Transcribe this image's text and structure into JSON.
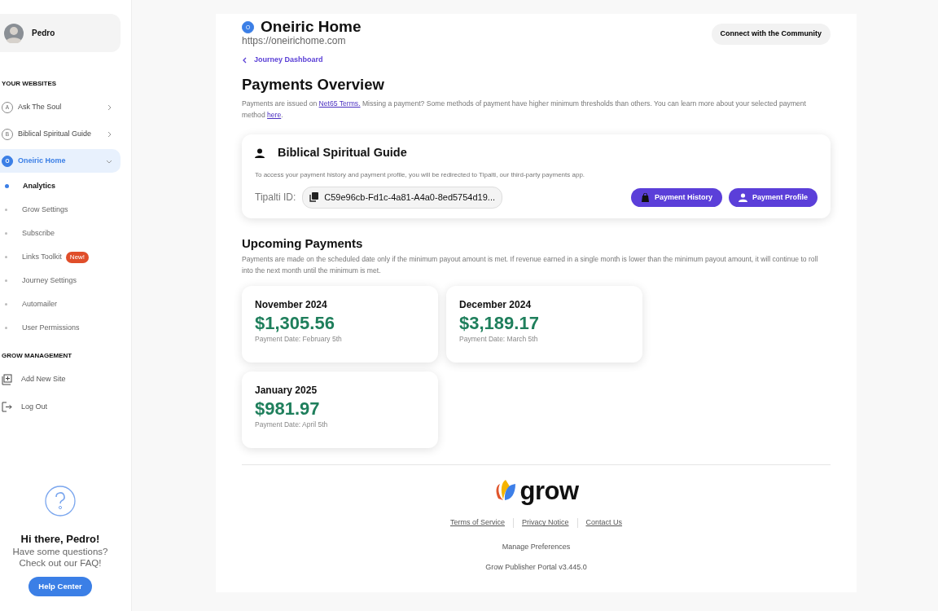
{
  "sidebar": {
    "user": {
      "name": "Pedro"
    },
    "websites_heading": "YOUR WEBSITES",
    "websites": [
      {
        "letter": "A",
        "label": "Ask The Soul",
        "selected": false,
        "expanded": false
      },
      {
        "letter": "B",
        "label": "Biblical Spiritual Guide",
        "selected": false,
        "expanded": false
      },
      {
        "letter": "O",
        "label": "Oneiric Home",
        "selected": true,
        "expanded": true,
        "children": [
          {
            "label": "Analytics",
            "selected": true
          },
          {
            "label": "Grow Settings",
            "selected": false
          },
          {
            "label": "Subscribe",
            "selected": false
          },
          {
            "label": "Links Toolkit",
            "selected": false,
            "badge": "New!"
          },
          {
            "label": "Journey Settings",
            "selected": false
          },
          {
            "label": "Automailer",
            "selected": false
          },
          {
            "label": "User Permissions",
            "selected": false
          }
        ]
      }
    ],
    "management_heading": "GROW MANAGEMENT",
    "management": [
      {
        "kind": "add",
        "label": "Add New Site"
      },
      {
        "kind": "logout",
        "label": "Log Out"
      }
    ],
    "help": {
      "title": "Hi there, Pedro!",
      "lines": [
        "Have some questions?",
        "Check out our FAQ!"
      ],
      "button": "Help Center"
    }
  },
  "main": {
    "site_letter": "O",
    "title": "Oneiric Home",
    "url": "https://oneirichome.com",
    "community_button": "Connect with the Community",
    "back_link": "Journey Dashboard",
    "heading": "Payments Overview",
    "intro": [
      {
        "kind": "text",
        "text": "Payments are issued on "
      },
      {
        "kind": "link",
        "text": "Net65 Terms."
      },
      {
        "kind": "text",
        "text": " Missing a payment? Some methods of payment have higher minimum thresholds than others. You can learn more about your selected payment method "
      },
      {
        "kind": "link",
        "text": "here"
      },
      {
        "kind": "text",
        "text": "."
      }
    ],
    "card": {
      "title": "Biblical Spiritual Guide",
      "note": "To access your payment history and payment profile, you will be redirected to Tipalti, our third-party payments app.",
      "id_label": "Tipalti ID:",
      "id_value": "C59e96cb-Fd1c-4a81-A4a0-8ed5754d19...",
      "buttons": [
        {
          "kind": "history",
          "label": "Payment History"
        },
        {
          "kind": "profile",
          "label": "Payment Profile"
        }
      ]
    },
    "upcoming": {
      "heading": "Upcoming Payments",
      "note": "Payments are made on the scheduled date only if the minimum payout amount is met. If revenue earned in a single month is lower than the minimum payout amount, it will continue to roll into the next month until the minimum is met.",
      "payments": [
        {
          "month": "November 2024",
          "amount": "$1,305.56",
          "date": "Payment Date: February 5th"
        },
        {
          "month": "December 2024",
          "amount": "$3,189.17",
          "date": "Payment Date: March 5th"
        },
        {
          "month": "January 2025",
          "amount": "$981.97",
          "date": "Payment Date: April 5th"
        }
      ]
    },
    "footer": {
      "brand": "grow",
      "links": [
        "Terms of Service",
        "Privacy Notice",
        "Contact Us"
      ],
      "manage": "Manage Preferences",
      "version": "Grow Publisher Portal v3.445.0"
    }
  }
}
